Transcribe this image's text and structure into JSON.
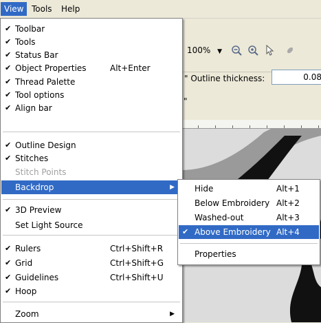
{
  "menubar": {
    "view": "View",
    "tools": "Tools",
    "help": "Help"
  },
  "toolbar": {
    "zoom_value": "100%",
    "outline_label": "\" Outline thickness:",
    "outline_value": "0.08",
    "row_tick": "\""
  },
  "view_menu": {
    "toolbar": "Toolbar",
    "tools": "Tools",
    "status_bar": "Status Bar",
    "object_properties": "Object Properties",
    "object_properties_sc": "Alt+Enter",
    "thread_palette": "Thread Palette",
    "tool_options": "Tool options",
    "align_bar": "Align bar",
    "outline_design": "Outline Design",
    "stitches": "Stitches",
    "stitch_points": "Stitch Points",
    "backdrop": "Backdrop",
    "preview_3d": "3D Preview",
    "set_light_source": "Set Light Source",
    "rulers": "Rulers",
    "rulers_sc": "Ctrl+Shift+R",
    "grid": "Grid",
    "grid_sc": "Ctrl+Shift+G",
    "guidelines": "Guidelines",
    "guidelines_sc": "Ctrl+Shift+U",
    "hoop": "Hoop",
    "zoom": "Zoom"
  },
  "backdrop_menu": {
    "hide": "Hide",
    "hide_sc": "Alt+1",
    "below": "Below Embroidery",
    "below_sc": "Alt+2",
    "washed": "Washed-out",
    "washed_sc": "Alt+3",
    "above": "Above Embroidery",
    "above_sc": "Alt+4",
    "properties": "Properties"
  },
  "colors": {
    "highlight": "#316ac5",
    "menu_bg": "#ffffff",
    "chrome": "#ece9d8",
    "disabled": "#a0a0a0"
  },
  "icons": [
    "check-icon",
    "submenu-arrow-icon",
    "zoom-out-icon",
    "zoom-in-icon",
    "help-pointer-icon",
    "dropdown-arrow-icon"
  ]
}
